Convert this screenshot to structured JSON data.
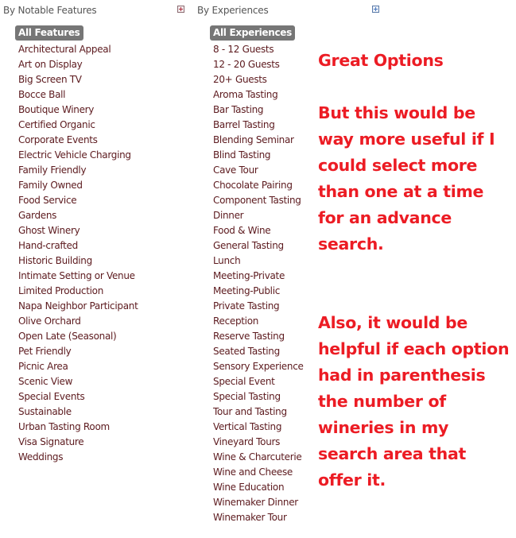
{
  "features": {
    "header": "By Notable Features",
    "expand_icon": "expand-plus-icon",
    "all_label": "All Features",
    "items": [
      "Architectural Appeal",
      "Art on Display",
      "Big Screen TV",
      "Bocce Ball",
      "Boutique Winery",
      "Certified Organic",
      "Corporate Events",
      "Electric Vehicle Charging",
      "Family Friendly",
      "Family Owned",
      "Food Service",
      "Gardens",
      "Ghost Winery",
      "Hand-crafted",
      "Historic Building",
      "Intimate Setting or Venue",
      "Limited Production",
      "Napa Neighbor Participant",
      "Olive Orchard",
      "Open Late (Seasonal)",
      "Pet Friendly",
      "Picnic Area",
      "Scenic View",
      "Special Events",
      "Sustainable",
      "Urban Tasting Room",
      "Visa Signature",
      "Weddings"
    ]
  },
  "experiences": {
    "header": "By Experiences",
    "expand_icon": "expand-plus-icon",
    "all_label": "All Experiences",
    "items": [
      "8 - 12 Guests",
      "12 - 20 Guests",
      "20+ Guests",
      "Aroma Tasting",
      "Bar Tasting",
      "Barrel Tasting",
      "Blending Seminar",
      "Blind Tasting",
      "Cave Tour",
      "Chocolate Pairing",
      "Component Tasting",
      "Dinner",
      "Food & Wine",
      "General Tasting",
      "Lunch",
      "Meeting-Private",
      "Meeting-Public",
      "Private Tasting",
      "Reception",
      "Reserve Tasting",
      "Seated Tasting",
      "Sensory Experience",
      "Special Event",
      "Special Tasting",
      "Tour and Tasting",
      "Vertical Tasting",
      "Vineyard Tours",
      "Wine & Charcuterie",
      "Wine and Cheese",
      "Wine Education",
      "Winemaker Dinner",
      "Winemaker Tour"
    ]
  },
  "annotations": {
    "title": "Great Options",
    "paragraph1": "But this would be way more useful if I could select more than one at a time for an advance search.",
    "paragraph2": "Also, it would be helpful if each option had in parenthesis the number of wineries in my search area that offer it.",
    "color": "#ec1c24"
  }
}
